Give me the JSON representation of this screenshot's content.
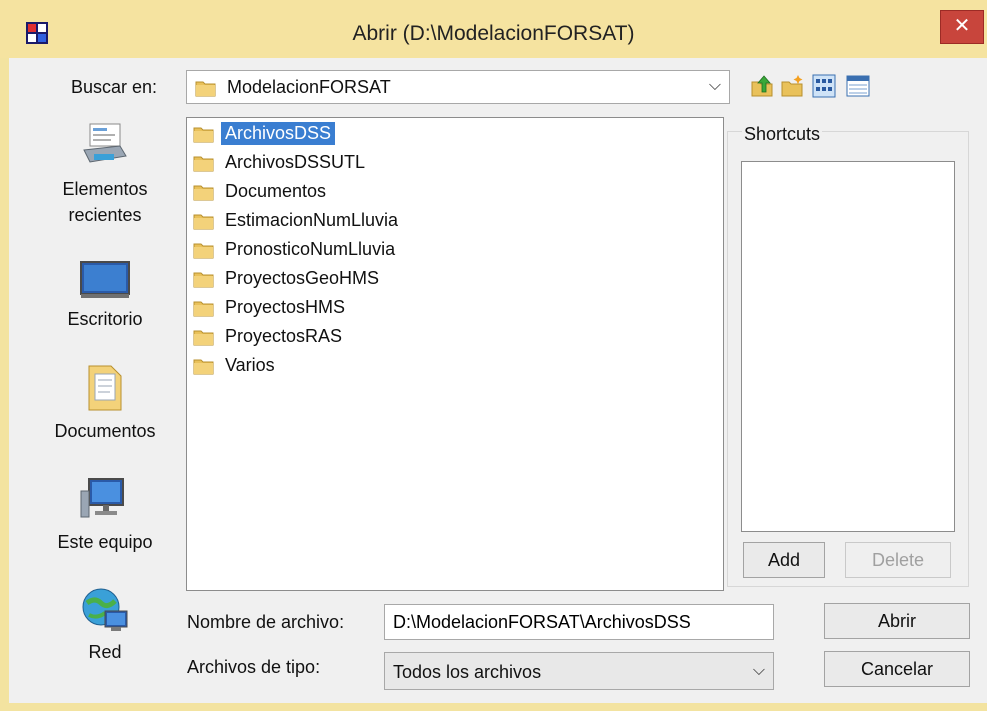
{
  "window": {
    "title": "Abrir (D:\\ModelacionFORSAT)",
    "close_glyph": "✕",
    "frame_color": "#f3e3a0",
    "close_color": "#c8453c"
  },
  "lookin": {
    "label": "Buscar en:",
    "value": "ModelacionFORSAT",
    "dropdown_icon": "chevron-down-icon"
  },
  "toolbar": {
    "up_icon": "up-one-level-icon",
    "new_folder_icon": "new-folder-icon",
    "list_view_icon": "list-view-icon",
    "details_view_icon": "details-view-icon"
  },
  "places": [
    {
      "label": "Elementos recientes",
      "icon": "recent-items-icon"
    },
    {
      "label": "Escritorio",
      "icon": "desktop-icon"
    },
    {
      "label": "Documentos",
      "icon": "documents-icon"
    },
    {
      "label": "Este equipo",
      "icon": "computer-icon"
    },
    {
      "label": "Red",
      "icon": "network-icon"
    }
  ],
  "files": [
    {
      "name": "ArchivosDSS",
      "selected": true
    },
    {
      "name": "ArchivosDSSUTL",
      "selected": false
    },
    {
      "name": "Documentos",
      "selected": false
    },
    {
      "name": "EstimacionNumLluvia",
      "selected": false
    },
    {
      "name": "PronosticoNumLluvia",
      "selected": false
    },
    {
      "name": "ProyectosGeoHMS",
      "selected": false
    },
    {
      "name": "ProyectosHMS",
      "selected": false
    },
    {
      "name": "ProyectosRAS",
      "selected": false
    },
    {
      "name": "Varios",
      "selected": false
    }
  ],
  "shortcuts": {
    "label": "Shortcuts",
    "add_label": "Add",
    "delete_label": "Delete"
  },
  "filename": {
    "label": "Nombre de archivo:",
    "value": "D:\\ModelacionFORSAT\\ArchivosDSS"
  },
  "filetype": {
    "label": "Archivos de tipo:",
    "value": "Todos los archivos"
  },
  "buttons": {
    "open_label": "Abrir",
    "cancel_label": "Cancelar"
  },
  "colors": {
    "selection": "#3a7ed1",
    "folder": "#e9c15a"
  }
}
